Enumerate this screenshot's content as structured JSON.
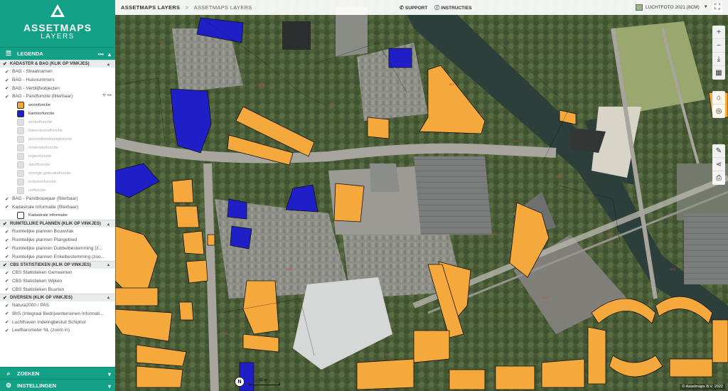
{
  "brand": {
    "name": "ASSETMAPS",
    "sub": "LAYERS"
  },
  "legend_bar": {
    "title": "LEGENDA",
    "more": "•••",
    "collapse": "▴"
  },
  "sections": [
    {
      "title": "KADASTER & BAG (KLIK OP VINKJES)",
      "layers": [
        {
          "label": "BAG - Straatnamen"
        },
        {
          "label": "BAG - Huisnummers"
        },
        {
          "label": "BAG - Verblijfsobjecten"
        },
        {
          "label": "BAG - Pandfunctie (filterbaar)"
        }
      ],
      "legend": [
        {
          "label": "woonfunctie",
          "color": "#f5a93c"
        },
        {
          "label": "kantoorfunctie",
          "color": "#1f1fc8"
        },
        {
          "label": "winkelfunctie"
        },
        {
          "label": "bijeenkomstfunctie"
        },
        {
          "label": "gezondheidszorgfunctie"
        },
        {
          "label": "onderwijsfunctie"
        },
        {
          "label": "logiesfunctie"
        },
        {
          "label": "sportfunctie"
        },
        {
          "label": "overige gebruiksfunctie"
        },
        {
          "label": "industriefunctie"
        },
        {
          "label": "celfunctie"
        }
      ],
      "layers_after": [
        {
          "label": "BAG - Pandbouwjaar (filterbaar)"
        },
        {
          "label": "Kadastrale Informatie (filterbaar)"
        }
      ],
      "legend_after": [
        {
          "label": "Kadastrale informatie",
          "color": "#ffffff"
        }
      ]
    },
    {
      "title": "RUIMTELIJKE PLANNEN (KLIK OP VINKJES)",
      "layers": [
        {
          "label": "Ruimtelijke plannen Bouwvlak"
        },
        {
          "label": "Ruimtelijke plannen Plangebied"
        },
        {
          "label": "Ruimtelijke plannen Dubbelbestemming (z..."
        },
        {
          "label": "Ruimtelijke plannen Enkelbestemming (zoo..."
        }
      ]
    },
    {
      "title": "CBS STATISTIEKEN (KLIK OP VINKJES)",
      "layers": [
        {
          "label": "CBS Statistieken Gemeenten"
        },
        {
          "label": "CBS Statistieken Wijken"
        },
        {
          "label": "CBS Statistieken Buurten"
        }
      ]
    },
    {
      "title": "DIVERSEN (KLIK OP VINKJES)",
      "layers": [
        {
          "label": "Natura2000 / PAS"
        },
        {
          "label": "IBIS (Integraal Bedrijventerreinen Informati..."
        },
        {
          "label": "Luchthaven Indelingbesluit Schiphol"
        },
        {
          "label": "Leefbarometer NL (zoom in)"
        }
      ]
    }
  ],
  "bottom": {
    "search": "ZOEKEN",
    "settings": "INSTELLINGEN"
  },
  "topbar": {
    "crumb_root": "ASSETMAPS LAYERS",
    "crumb_sep": ">",
    "crumb_current": "ASSETMAPS LAYERS",
    "support": "SUPPORT",
    "instructies": "INSTRUCTIES",
    "basemap": "LUCHTFOTO 2021 (8CM)"
  },
  "map": {
    "scale": "50 m",
    "north": "N",
    "copyright": "© Assetmaps B.V. 2022"
  },
  "colors": {
    "brand": "#12a086",
    "woon": "#f5a93c",
    "kantoor": "#1f1fc8"
  }
}
